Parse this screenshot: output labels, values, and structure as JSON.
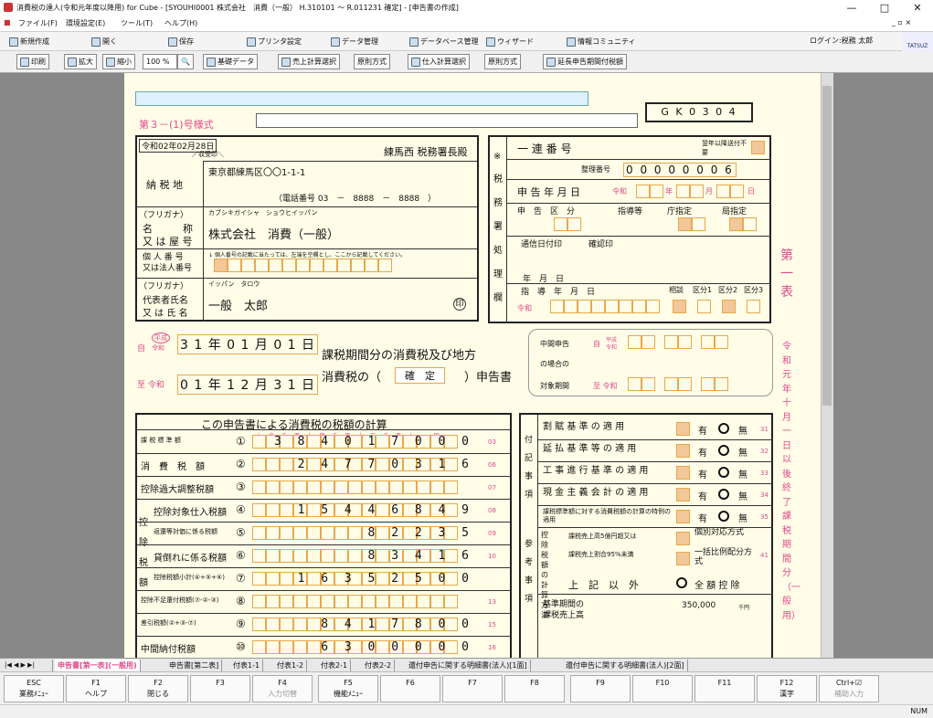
{
  "window": {
    "title": "消費税の達人(令和元年度以降用) for Cube - [SYOUHI0001 株式会社　消費（一般） H.310101 ～ R.011231 確定] - [申告書の作成]",
    "min": "—",
    "max": "□",
    "close": "✕"
  },
  "menu": [
    "ファイル(F)",
    "環境設定(E)",
    "ツール(T)",
    "ヘルプ(H)"
  ],
  "mdi_controls": "_ ▫ ×",
  "toolbar1": [
    "新規作成",
    "開く",
    "保存",
    "プリンタ設定",
    "データ管理",
    "データベース管理",
    "ウィザード",
    "情報コミュニティ"
  ],
  "login": "ログイン:税務 太郎",
  "logo": "TATSUZ",
  "toolbar2": {
    "print": "印刷",
    "zoom_in": "拡大",
    "zoom_out": "縮小",
    "zoom": "100 %",
    "zoom_icon": "🔍",
    "basic": "基礎データ",
    "sales": "売上計算選択",
    "sales_method": "原則方式",
    "purchase": "仕入計算選択",
    "purchase_method": "原則方式",
    "extension": "延長申告期間付税額"
  },
  "form": {
    "form_no": "第３－(1)号様式",
    "code": "G K 0 3 0 4",
    "date": "令和02年02月28日",
    "receipt": "／収受印＼",
    "office": "練馬西 税務署長殿",
    "addr_label": "納 税 地",
    "addr": "東京都練馬区〇〇1-1-1",
    "tel": "（電話番号 03　－　8888　－　8888　）",
    "furigana_label": "（フリガナ）",
    "furigana": "カブシキガイシャ　ショウヒイッパン",
    "name_label1": "名　　　称",
    "name_label2": "又 は 屋 号",
    "name": "株式会社　消費（一般）",
    "corp_no_label1": "個 人 番 号",
    "corp_no_label2": "又は法人番号",
    "corp_no_note": "↓ 個人番号の記載に当たっては、左端を空欄とし、ここから記載してください。",
    "rep_furigana_label": "（フリガナ）",
    "rep_furigana": "イッパン　タロウ",
    "rep_label1": "代表者氏名",
    "rep_label2": "又 は 氏 名",
    "rep": "一般　太郎",
    "seal": "印",
    "office_use": {
      "mark": "※",
      "vertical": "税務署処理欄",
      "serial": "一 連 番 号",
      "serial_note": "翌年以降送付不要",
      "mgmt_no_label": "整理番号",
      "mgmt_no": "0 0 0 0 0 0 0 6",
      "report_date": "申 告 年 月 日",
      "reiwa": "令和",
      "year": "年",
      "month": "月",
      "day": "日",
      "category": "申　告　区　分",
      "guidance": "指導等",
      "office_designated": "庁指定",
      "station": "局指定",
      "comm_date": "通信日付印",
      "verified": "確認印",
      "ymd": "年　月　日",
      "guide_ymd": "指　導　年　月　日",
      "consult": "相談",
      "kubun1": "区分1",
      "kubun2": "区分2",
      "kubun3": "区分3"
    },
    "period_from_label": "自",
    "era_heisei": "平成",
    "era_reiwa": "令和",
    "period_from": "3 1 年 0 1 月 0 1 日",
    "period_to_label": "至 令和",
    "period_to": "0 1 年 1 2 月 3 1 日",
    "title1": "課税期間分の消費税及び地方",
    "title2": "消費税の（",
    "status": "確　定",
    "title3": "）申告書",
    "interim1": "中間申告",
    "interim2": "の場合の",
    "interim3": "対象期間",
    "interim_from": "自",
    "interim_to": "至 令和",
    "side_title": "第一表",
    "side_note": "令和元年十月一日以後終了課税期間分（一般用）",
    "calc_title": "この申告書による消費税の税額の計算",
    "digits": "十 兆 千 百 十 億 千 百 十 万 千 百 十 一 円",
    "rows": [
      {
        "label": "課 税 標 準 額",
        "no": "①",
        "value": "3 8 4 0 1 7 0 0 0",
        "code": "03"
      },
      {
        "label": "消　費　税　額",
        "no": "②",
        "value": "2 4 7 7 0 3 1 6",
        "code": "06"
      },
      {
        "label": "控除過大調整税額",
        "no": "③",
        "value": "",
        "code": "07"
      },
      {
        "label": "控除対象仕入税額",
        "no": "④",
        "value": "1 5 4 4 6 8 4 9",
        "code": "08"
      },
      {
        "label": "返還等対価に係る税額",
        "no": "⑤",
        "value": "8 2 2 3 5",
        "code": "09"
      },
      {
        "label": "貸倒れに係る税額",
        "no": "⑥",
        "value": "8 3 4 1 6",
        "code": "10"
      },
      {
        "label": "控除税額小計(④+⑤+⑥)",
        "no": "⑦",
        "value": "1 6 3 5 2 5 0 0",
        "code": ""
      },
      {
        "label": "控除不足還付税額(⑦-②-③)",
        "no": "⑧",
        "value": "",
        "code": "13"
      },
      {
        "label": "差引税額(②+③-⑦)",
        "no": "⑨",
        "value": "8 4 1 7 8 0 0",
        "code": "15"
      },
      {
        "label": "中間納付税額",
        "no": "⑩",
        "value": "6 3 0 0 0 0 0",
        "code": "16"
      }
    ],
    "deduct_vertical": "控除税額",
    "notes_vertical1": "付記事項",
    "notes_vertical2": "参考事項",
    "notes": [
      {
        "label": "割 賦 基 準 の 適 用",
        "yes": "有",
        "no": "無",
        "code": "31"
      },
      {
        "label": "延 払 基 準 等 の 適 用",
        "yes": "有",
        "no": "無",
        "code": "32"
      },
      {
        "label": "工 事 進 行 基 準 の 適 用",
        "yes": "有",
        "no": "無",
        "code": "33"
      },
      {
        "label": "現 金 主 義 会 計 の 適 用",
        "yes": "有",
        "no": "無",
        "code": "34"
      },
      {
        "label": "課税標準額に対する消費税額の計算の特例の適用",
        "yes": "有",
        "no": "無",
        "code": "35"
      }
    ],
    "method_vertical": "控除税額の計算方法",
    "method_sub": "課税売上高5億円超又は",
    "method_sub2": "課税売上割合95%未満",
    "kobetsu": "個別対応方式",
    "ikkatsu": "一括比例配分方式",
    "other": "上　記　以　外",
    "zengaku": "全 額 控 除",
    "code41": "41",
    "base_label1": "基準期間の",
    "base_label2": "課税売上高",
    "base_value": "350,000",
    "base_unit": "千円"
  },
  "tabs": [
    "申告書[第一表](一般用)",
    "申告書[第二表]",
    "付表1-1",
    "付表1-2",
    "付表2-1",
    "付表2-2",
    "還付申告に関する明細書(法人)[1面]",
    "還付申告に関する明細書(法人)[2面]"
  ],
  "fkeys": [
    {
      "k": "ESC",
      "l": "業務ﾒﾆｭｰ"
    },
    {
      "k": "F1",
      "l": "ヘルプ"
    },
    {
      "k": "F2",
      "l": "閉じる"
    },
    {
      "k": "F3",
      "l": ""
    },
    {
      "k": "F4",
      "l": "入力切替"
    },
    {
      "k": "F5",
      "l": "機能ﾒﾆｭｰ"
    },
    {
      "k": "F6",
      "l": ""
    },
    {
      "k": "F7",
      "l": ""
    },
    {
      "k": "F8",
      "l": ""
    },
    {
      "k": "F9",
      "l": ""
    },
    {
      "k": "F10",
      "l": ""
    },
    {
      "k": "F11",
      "l": ""
    },
    {
      "k": "F12",
      "l": "漢字"
    },
    {
      "k": "Ctrl+☑",
      "l": "補助入力"
    }
  ],
  "status": "NUM",
  "colors": {
    "pink": "#e04a8a",
    "cell_border": "#e9a74a",
    "paper": "#fffde7",
    "workspace": "#888888"
  }
}
